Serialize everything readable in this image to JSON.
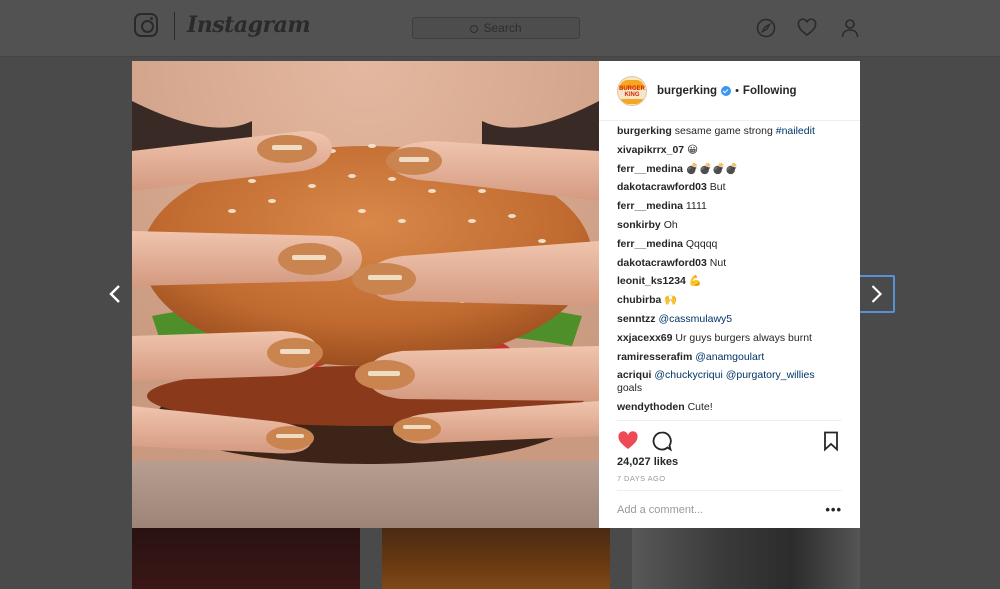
{
  "header": {
    "brand": "Instagram",
    "search_placeholder": "Search"
  },
  "post": {
    "username": "burgerking",
    "avatar_text": "BURGER KING",
    "dot": "•",
    "follow_status": "Following",
    "likes": "24,027 likes",
    "time_ago": "7 DAYS AGO",
    "comment_placeholder": "Add a comment...",
    "more": "•••",
    "comments": [
      {
        "user": "burgerking",
        "text": "sesame game strong",
        "tag": "#nailedit"
      },
      {
        "user": "xivapikrrx_07",
        "text": "😀"
      },
      {
        "user": "ferr__medina",
        "text": "💣💣💣💣"
      },
      {
        "user": "dakotacrawford03",
        "text": "But"
      },
      {
        "user": "ferr__medina",
        "text": "1111"
      },
      {
        "user": "sonkirby",
        "text": "Oh"
      },
      {
        "user": "ferr__medina",
        "text": "Qqqqq"
      },
      {
        "user": "dakotacrawford03",
        "text": "Nut"
      },
      {
        "user": "leonit_ks1234",
        "text": "💪"
      },
      {
        "user": "chubirba",
        "text": "🙌"
      },
      {
        "user": "senntzz",
        "tag": "@cassmulawy5"
      },
      {
        "user": "xxjacexx69",
        "text": "Ur guys burgers always burnt"
      },
      {
        "user": "ramiresserafim",
        "tag": "@anamgoulart"
      },
      {
        "user": "acriqui",
        "tag": "@chuckycriqui @purgatory_willies",
        "text2": "goals"
      },
      {
        "user": "wendythoden",
        "text": "Cute!"
      }
    ]
  },
  "colors": {
    "like_red": "#ed4956",
    "link_blue": "#003569",
    "verified_blue": "#3897f0",
    "focus_outline": "#5b8fd6"
  }
}
